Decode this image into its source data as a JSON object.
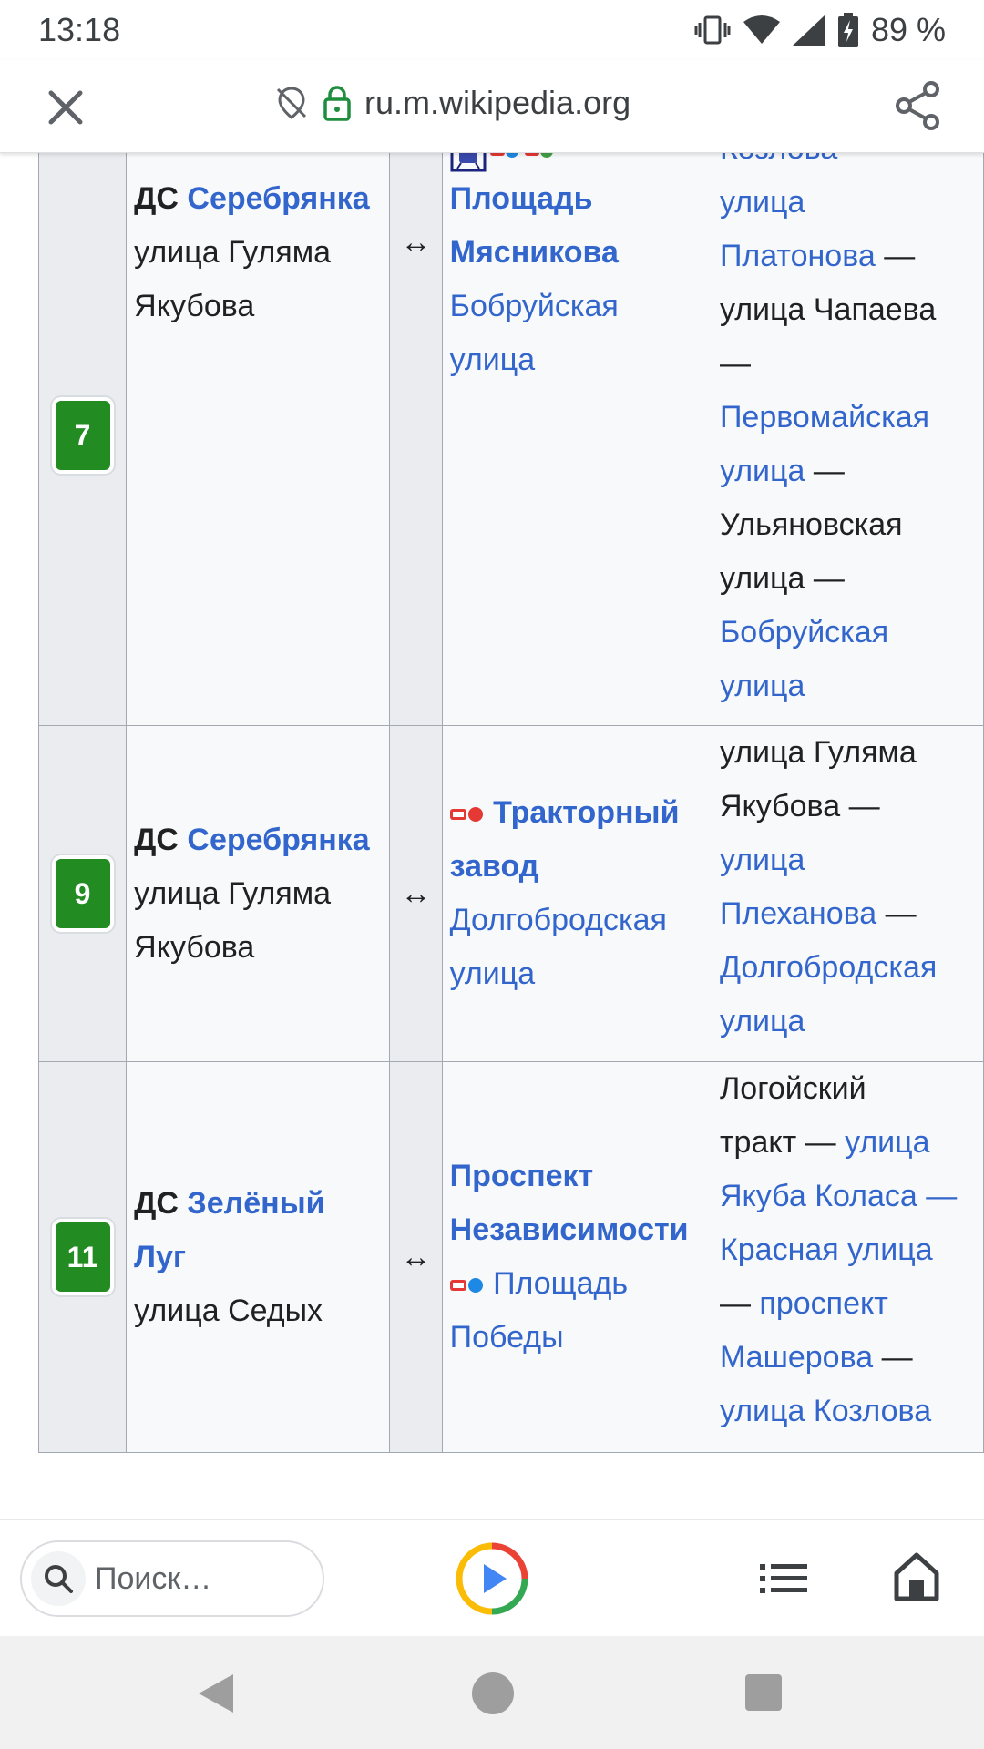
{
  "status_bar": {
    "time": "13:18",
    "battery": "89 %",
    "icons": [
      "vibrate-icon",
      "wifi-icon",
      "signal-icon",
      "battery-icon"
    ]
  },
  "url_bar": {
    "url": "ru.m.wikipedia.org",
    "icons": [
      "close-icon",
      "location-off-icon",
      "lock-icon",
      "share-icon"
    ]
  },
  "rows": [
    {
      "number": "7",
      "from_prefix": "ДС",
      "from_link": "Серебрянка",
      "from_street": "улица Гуляма Якубова",
      "arrow": "↔",
      "to_main": "Площадь Мясникова",
      "to_street": "Бобруйская улица",
      "via": {
        "l1": "Козлова",
        "l1b": " —",
        "l2": "улица",
        "l3": "Платонова",
        "l3b": " —",
        "l4": "улица Чапаева",
        "l5": "—",
        "l6": "Первомайская",
        "l7": "улица",
        "l7b": " —",
        "l8": "Ульяновская",
        "l9": "улица —",
        "l10": "Бобруйская",
        "l11": "улица"
      }
    },
    {
      "number": "9",
      "from_prefix": "ДС",
      "from_link": "Серебрянка",
      "from_street": "улица Гуляма Якубова",
      "arrow": "↔",
      "to_main": "Тракторный завод",
      "to_street": "Долгобродская улица",
      "via": {
        "l1": "улица Гуляма",
        "l2": "Якубова —",
        "l3": "улица",
        "l4": "Плеханова",
        "l4b": " —",
        "l5": "Долгобродская",
        "l6": "улица"
      }
    },
    {
      "number": "11",
      "from_prefix": "ДС",
      "from_link": "Зелёный Луг",
      "from_street": "улица Седых",
      "arrow": "↔",
      "to_main": "Проспект Независимости",
      "to_sub": "Площадь Победы",
      "via": {
        "l1": "Логойский",
        "l2a": "тракт — ",
        "l2b": "улица",
        "l3": "Якуба Коласа —",
        "l4": "Красная улица",
        "l5a": "— ",
        "l5b": "проспект",
        "l6": "Машерова",
        "l6b": " —",
        "l7": "улица Козлова"
      }
    }
  ],
  "toolbar": {
    "search_placeholder": "Поиск…",
    "icons": [
      "search-icon",
      "play-icon",
      "list-icon",
      "home-icon"
    ]
  },
  "colors": {
    "link": "#3366cc",
    "badge": "#228b22",
    "cell_bg": "#f8f9fa",
    "header_cell_bg": "#eaecf0",
    "border": "#a2a9b1"
  }
}
